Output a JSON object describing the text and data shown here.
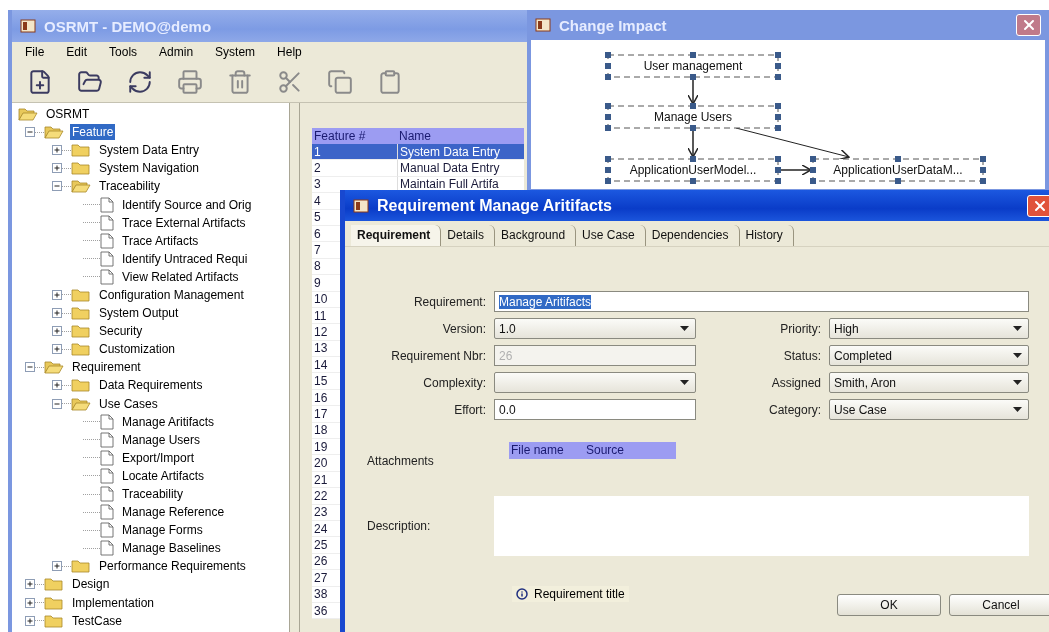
{
  "main_window": {
    "title": "OSRMT - DEMO@demo",
    "menu": [
      "File",
      "Edit",
      "Tools",
      "Admin",
      "System",
      "Help"
    ]
  },
  "tree": {
    "label": "OSRMT",
    "kind": "folder",
    "expanded": true,
    "selected": false,
    "children": [
      {
        "label": "Feature",
        "kind": "folder",
        "expanded": true,
        "selected": true,
        "children": [
          {
            "label": "System Data Entry",
            "kind": "folder",
            "expanded": false,
            "selected": false
          },
          {
            "label": "System Navigation",
            "kind": "folder",
            "expanded": false,
            "selected": false
          },
          {
            "label": "Traceability",
            "kind": "folder",
            "expanded": true,
            "selected": false,
            "children": [
              {
                "label": "Identify Source and Orig",
                "kind": "document",
                "selected": false
              },
              {
                "label": "Trace External Artifacts",
                "kind": "document",
                "selected": false
              },
              {
                "label": "Trace Artifacts",
                "kind": "document",
                "selected": false
              },
              {
                "label": "Identify Untraced Requi",
                "kind": "document",
                "selected": false
              },
              {
                "label": "View Related Artifacts",
                "kind": "document",
                "selected": false
              }
            ]
          },
          {
            "label": "Configuration Management",
            "kind": "folder",
            "expanded": false,
            "selected": false
          },
          {
            "label": "System Output",
            "kind": "folder",
            "expanded": false,
            "selected": false
          },
          {
            "label": "Security",
            "kind": "folder",
            "expanded": false,
            "selected": false
          },
          {
            "label": "Customization",
            "kind": "folder",
            "expanded": false,
            "selected": false
          }
        ]
      },
      {
        "label": "Requirement",
        "kind": "folder",
        "expanded": true,
        "selected": false,
        "children": [
          {
            "label": "Data Requirements",
            "kind": "folder",
            "expanded": false,
            "selected": false
          },
          {
            "label": "Use Cases",
            "kind": "folder",
            "expanded": true,
            "selected": false,
            "children": [
              {
                "label": "Manage Aritifacts",
                "kind": "document",
                "selected": false
              },
              {
                "label": "Manage Users",
                "kind": "document",
                "selected": false
              },
              {
                "label": "Export/Import",
                "kind": "document",
                "selected": false
              },
              {
                "label": "Locate Artifacts",
                "kind": "document",
                "selected": false
              },
              {
                "label": "Traceability",
                "kind": "document",
                "selected": false
              },
              {
                "label": "Manage Reference",
                "kind": "document",
                "selected": false
              },
              {
                "label": "Manage Forms",
                "kind": "document",
                "selected": false
              },
              {
                "label": "Manage Baselines",
                "kind": "document",
                "selected": false
              }
            ]
          },
          {
            "label": "Performance Requirements",
            "kind": "folder",
            "expanded": false,
            "selected": false
          }
        ]
      },
      {
        "label": "Design",
        "kind": "folder",
        "expanded": false,
        "selected": false
      },
      {
        "label": "Implementation",
        "kind": "folder",
        "expanded": false,
        "selected": false
      },
      {
        "label": "TestCase",
        "kind": "folder",
        "expanded": false,
        "selected": false
      }
    ]
  },
  "table": {
    "columns": [
      "Feature #",
      "Name"
    ],
    "rows": [
      {
        "number": "1",
        "name": "System Data Entry",
        "selected": true
      },
      {
        "number": "2",
        "name": "Manual Data Entry",
        "selected": false
      },
      {
        "number": "3",
        "name": "Maintain Full Artifa",
        "selected": false
      },
      {
        "number": "4",
        "selected": false
      },
      {
        "number": "5",
        "selected": false
      },
      {
        "number": "6",
        "selected": false
      },
      {
        "number": "7",
        "selected": false
      },
      {
        "number": "8",
        "selected": false
      },
      {
        "number": "9",
        "selected": false
      },
      {
        "number": "10",
        "selected": false
      },
      {
        "number": "11",
        "selected": false
      },
      {
        "number": "12",
        "selected": false
      },
      {
        "number": "13",
        "selected": false
      },
      {
        "number": "14",
        "selected": false
      },
      {
        "number": "15",
        "selected": false
      },
      {
        "number": "16",
        "selected": false
      },
      {
        "number": "17",
        "selected": false
      },
      {
        "number": "18",
        "selected": false
      },
      {
        "number": "19",
        "selected": false
      },
      {
        "number": "20",
        "selected": false
      },
      {
        "number": "21",
        "selected": false
      },
      {
        "number": "22",
        "selected": false
      },
      {
        "number": "23",
        "selected": false
      },
      {
        "number": "24",
        "selected": false
      },
      {
        "number": "25",
        "selected": false
      },
      {
        "number": "26",
        "selected": false
      },
      {
        "number": "27",
        "selected": false
      },
      {
        "number": "38",
        "selected": false
      },
      {
        "number": "36",
        "selected": false
      }
    ]
  },
  "change_impact": {
    "title": "Change Impact",
    "nodes": [
      {
        "label": "User management"
      },
      {
        "label": "Manage Users"
      },
      {
        "label": "ApplicationUserModel..."
      },
      {
        "label": "ApplicationUserDataM..."
      }
    ]
  },
  "dialog": {
    "title": "Requirement Manage Aritifacts",
    "tabs": [
      {
        "label": "Requirement",
        "selected": true
      },
      {
        "label": "Details",
        "selected": false
      },
      {
        "label": "Background",
        "selected": false
      },
      {
        "label": "Use Case",
        "selected": false
      },
      {
        "label": "Dependencies",
        "selected": false
      },
      {
        "label": "History",
        "selected": false
      }
    ],
    "requirement": {
      "label": "Requirement:",
      "value": "Manage Aritifacts",
      "kind": "text",
      "text_selected": true
    },
    "left_fields": [
      {
        "label": "Version:",
        "value": "1.0",
        "kind": "combo"
      },
      {
        "label": "Requirement Nbr:",
        "value": "26",
        "kind": "disabled"
      },
      {
        "label": "Complexity:",
        "kind": "combo"
      },
      {
        "label": "Effort:",
        "value": "0.0",
        "kind": "text"
      }
    ],
    "right_fields": [
      {
        "label": "Priority:",
        "value": "High",
        "kind": "combo"
      },
      {
        "label": "Status:",
        "value": "Completed",
        "kind": "combo"
      },
      {
        "label": "Assigned",
        "value": "Smith, Aron",
        "kind": "combo"
      },
      {
        "label": "Category:",
        "value": "Use Case",
        "kind": "combo"
      }
    ],
    "attachments": {
      "label": "Attachments",
      "columns": [
        "File name",
        "Source"
      ]
    },
    "description": {
      "label": "Description:"
    },
    "hint": "Requirement title",
    "buttons": [
      "OK",
      "Cancel"
    ]
  }
}
